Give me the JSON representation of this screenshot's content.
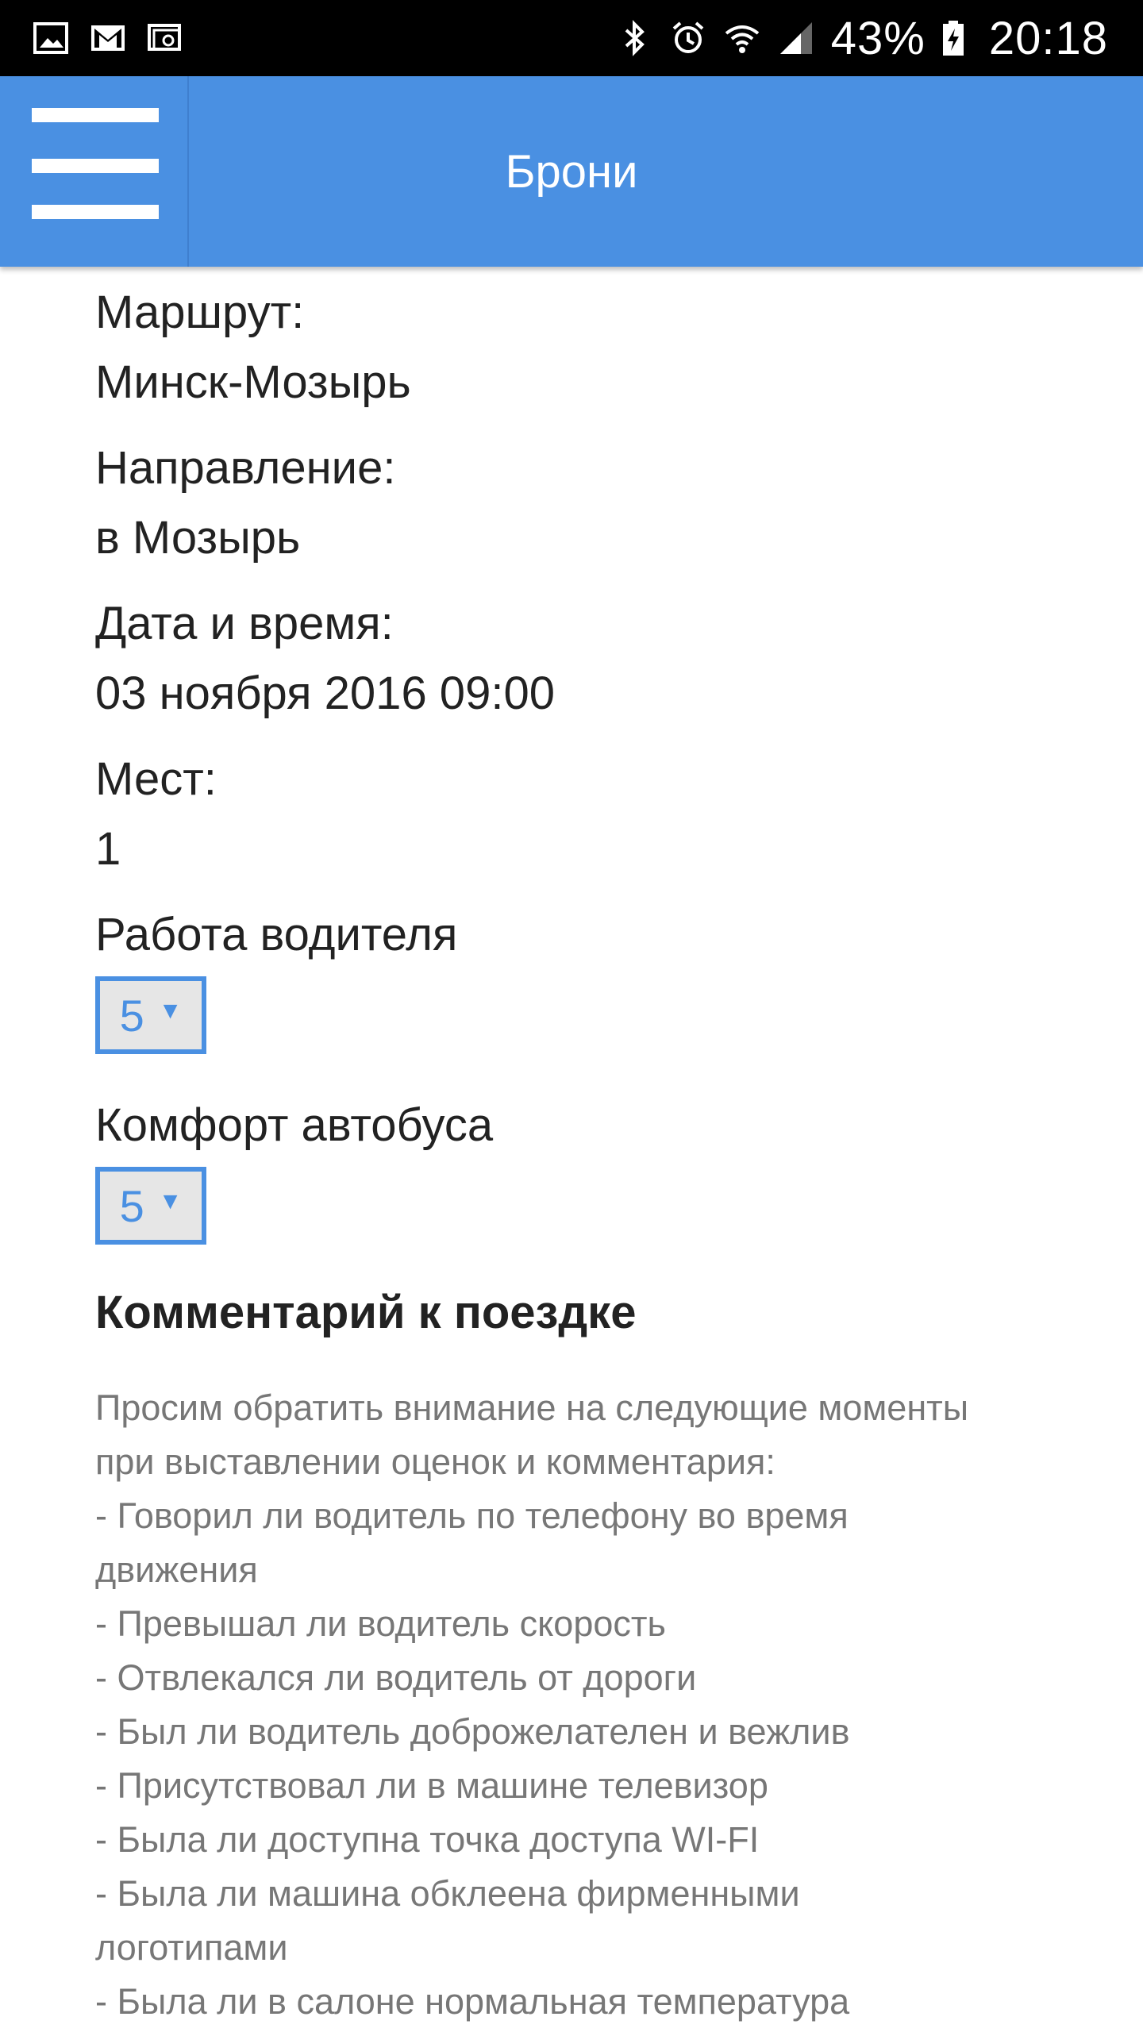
{
  "status_bar": {
    "left_icons": [
      "image-icon",
      "gmail-icon",
      "cast-icon"
    ],
    "right_icons": [
      "bluetooth-icon",
      "alarm-icon",
      "wifi-icon",
      "signal-icon"
    ],
    "battery_percent": "43%",
    "battery_icon": "battery-charging-icon",
    "time": "20:18"
  },
  "app_bar": {
    "menu_icon": "menu-icon",
    "title": "Брони"
  },
  "booking": {
    "route_label": "Маршрут:",
    "route_value": "Минск-Мозырь",
    "direction_label": "Направление:",
    "direction_value": "в Мозырь",
    "datetime_label": "Дата и время:",
    "datetime_value": "03 ноября 2016 09:00",
    "seats_label": "Мест:",
    "seats_value": "1"
  },
  "ratings": {
    "driver_label": "Работа водителя",
    "driver_value": "5",
    "comfort_label": "Комфорт автобуса",
    "comfort_value": "5",
    "arrow": "▼"
  },
  "comment": {
    "title": "Комментарий к поездке",
    "lines": [
      "Просим обратить внимание на следующие моменты",
      "при выставлении оценок и комментария:",
      "- Говорил ли водитель по телефону во время",
      "движения",
      "- Превышал ли водитель скорость",
      "- Отвлекался ли водитель от дороги",
      "- Был ли водитель доброжелателен и вежлив",
      "- Присутствовал ли в машине телевизор",
      "- Была ли доступна точка доступа WI-FI",
      "- Была ли машина обклеена фирменными",
      "логотипами",
      "- Была ли в салоне нормальная температура"
    ]
  },
  "colors": {
    "app_bar": "#4a90e2",
    "status_bar": "#000000",
    "text": "#222222",
    "hint_text": "#777777",
    "select_bg": "#e6e6e6"
  }
}
